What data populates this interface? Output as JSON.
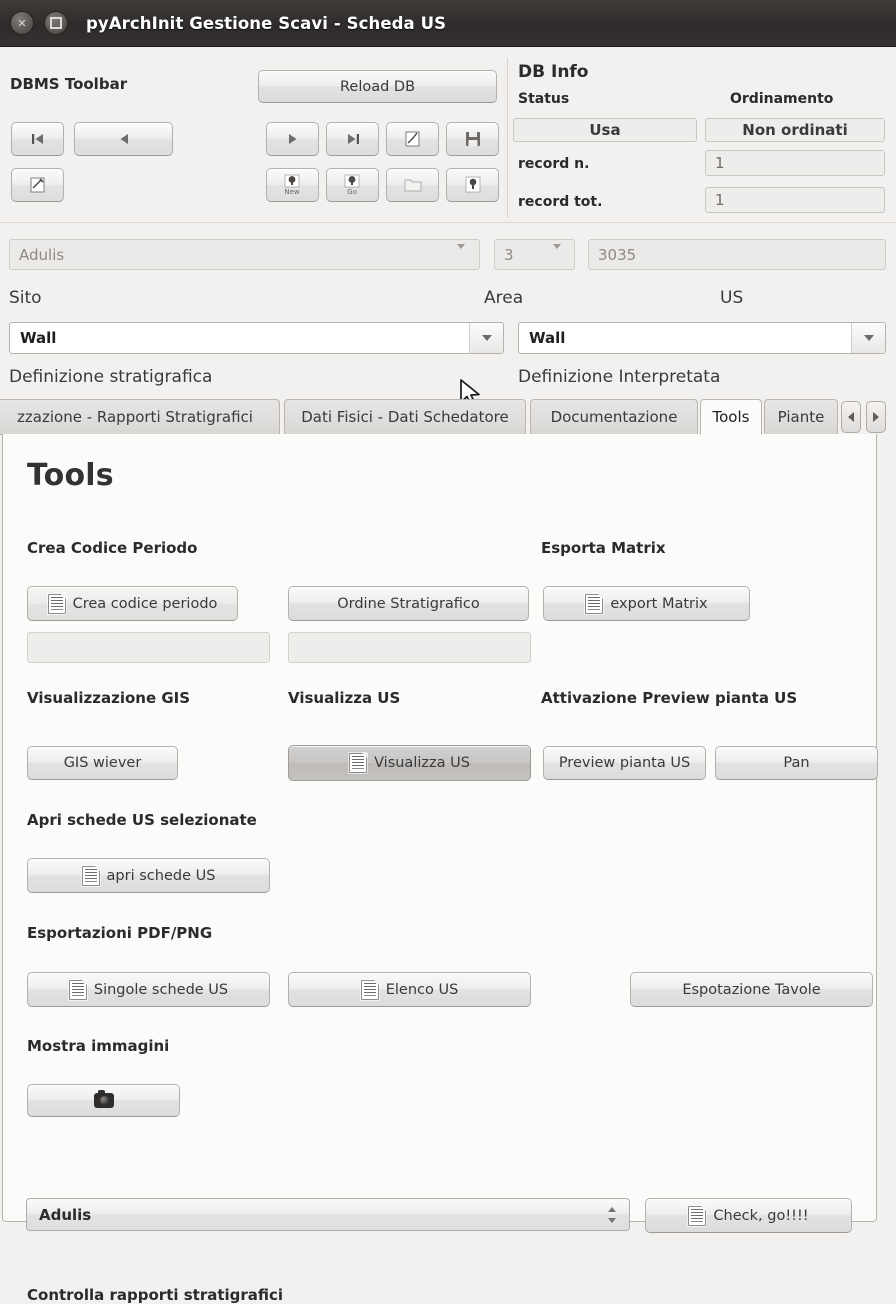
{
  "window": {
    "title": "pyArchInit Gestione Scavi - Scheda US",
    "close_icon": "close-icon",
    "maximize_icon": "maximize-icon"
  },
  "dbms_toolbar": {
    "label": "DBMS Toolbar",
    "reload_label": "Reload DB",
    "left_buttons": [
      {
        "name": "first-record-button",
        "icon": "skip-to-start-icon"
      },
      {
        "name": "previous-record-button",
        "icon": "previous-icon"
      },
      {
        "name": "edit-record-button",
        "icon": "edit-sheet-icon"
      }
    ],
    "right_buttons": [
      {
        "name": "next-record-button",
        "icon": "play-next-icon"
      },
      {
        "name": "last-record-button",
        "icon": "skip-to-end-icon"
      },
      {
        "name": "modify-record-button",
        "icon": "edit-pencil-sheet-icon"
      },
      {
        "name": "save-record-button",
        "icon": "floppy-save-icon"
      },
      {
        "name": "new-record-button",
        "icon": "new-pin-icon",
        "caption": "New"
      },
      {
        "name": "go-search-button",
        "icon": "go-pin-icon",
        "caption": "Go"
      },
      {
        "name": "open-folder-button",
        "icon": "folder-icon"
      },
      {
        "name": "search-pin-button",
        "icon": "search-pin-icon"
      }
    ]
  },
  "db_info": {
    "title": "DB Info",
    "status_label": "Status",
    "status_value": "Usa",
    "ordinamento_label": "Ordinamento",
    "ordinamento_value": "Non ordinati",
    "record_n_label": "record n.",
    "record_n_value": "1",
    "record_tot_label": "record tot.",
    "record_tot_value": "1"
  },
  "identity_row": {
    "sito_value": "Adulis",
    "area_value": "3",
    "us_value": "3035"
  },
  "labels_row": {
    "sito": "Sito",
    "area": "Area",
    "us": "US"
  },
  "definizione_row": {
    "stratigrafica_value": "Wall",
    "interpretata_value": "Wall",
    "stratigrafica_label": "Definizione stratigrafica",
    "interpretata_label": "Definizione Interpretata"
  },
  "tabs": {
    "items": [
      {
        "label": "zzazione - Rapporti Stratigrafici",
        "active": false
      },
      {
        "label": "Dati Fisici - Dati Schedatore",
        "active": false
      },
      {
        "label": "Documentazione",
        "active": false
      },
      {
        "label": "Tools",
        "active": true
      },
      {
        "label": "Piante",
        "active": false
      }
    ],
    "scroll_left_icon": "chevron-left-icon",
    "scroll_right_icon": "chevron-right-icon"
  },
  "tools": {
    "heading": "Tools",
    "crea_codice_periodo": {
      "group_label": "Crea Codice Periodo",
      "button_label": "Crea codice periodo",
      "ordine_button_label": "Ordine Stratigrafico",
      "field1_value": "",
      "field2_value": ""
    },
    "esporta_matrix": {
      "group_label": "Esporta Matrix",
      "button_label": "export Matrix"
    },
    "visualizzazione_gis": {
      "group_label": "Visualizzazione GIS",
      "button_label": "GIS wiever"
    },
    "visualizza_us": {
      "group_label": "Visualizza US",
      "button_label": "Visualizza US"
    },
    "preview_pianta": {
      "group_label": "Attivazione Preview pianta US",
      "preview_button_label": "Preview pianta US",
      "pan_button_label": "Pan"
    },
    "apri_schede": {
      "group_label": "Apri schede US selezionate",
      "button_label": "apri schede US"
    },
    "esportazioni": {
      "group_label": "Esportazioni PDF/PNG",
      "singole_label": "Singole schede US",
      "elenco_label": "Elenco US",
      "tavole_label": "Espotazione Tavole"
    },
    "mostra_immagini": {
      "group_label": "Mostra immagini",
      "button_icon": "camera-icon"
    },
    "controlla_rapporti": {
      "group_label": "Controlla rapporti stratigrafici",
      "select_value": "Adulis",
      "check_button_label": "Check, go!!!!"
    }
  }
}
